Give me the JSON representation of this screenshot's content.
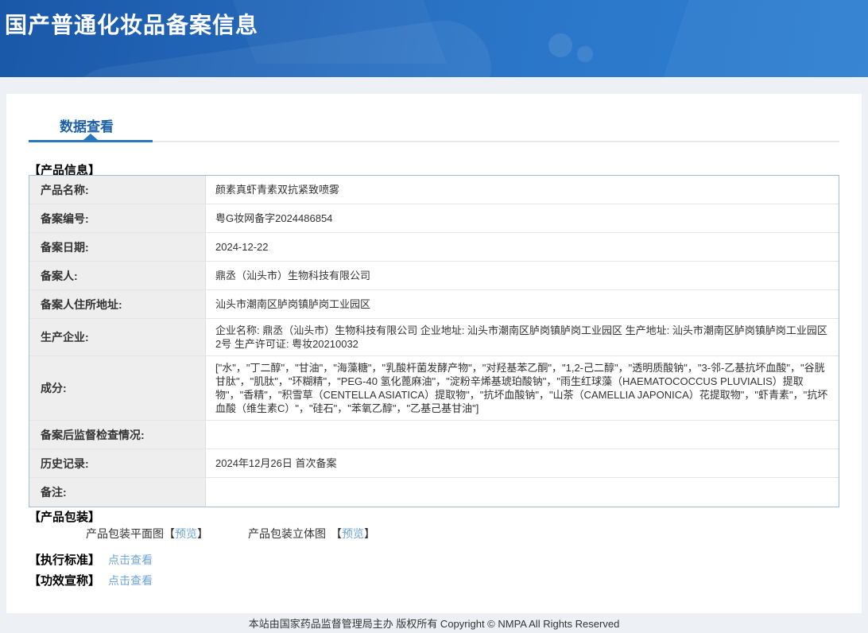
{
  "header": {
    "title": "国产普通化妆品备案信息"
  },
  "tabs": {
    "data_view": "数据查看"
  },
  "sections": {
    "product_info": "【产品信息】",
    "packaging": "【产品包装】",
    "standard": "【执行标准】",
    "efficacy": "【功效宣称】"
  },
  "table": {
    "rows": [
      {
        "label": "产品名称:",
        "value": "颜素真虾青素双抗紧致喷雾"
      },
      {
        "label": "备案编号:",
        "value": "粤G妆网备字2024486854"
      },
      {
        "label": "备案日期:",
        "value": "2024-12-22"
      },
      {
        "label": "备案人:",
        "value": "鼎丞（汕头市）生物科技有限公司"
      },
      {
        "label": "备案人住所地址:",
        "value": "汕头市潮南区胪岗镇胪岗工业园区"
      },
      {
        "label": "生产企业:",
        "value": "企业名称: 鼎丞（汕头市）生物科技有限公司 企业地址: 汕头市潮南区胪岗镇胪岗工业园区 生产地址: 汕头市潮南区胪岗镇胪岗工业园区2号 生产许可证: 粤妆20210032"
      },
      {
        "label": "成分:",
        "value": "[\"水\"，\"丁二醇\"，\"甘油\"，\"海藻糖\"，\"乳酸杆菌发酵产物\"，\"对羟基苯乙酮\"，\"1,2-己二醇\"，\"透明质酸钠\"，\"3-邻-乙基抗坏血酸\"，\"谷胱甘肽\"，\"肌肽\"，\"环糊精\"，\"PEG-40 氢化蓖麻油\"，\"淀粉辛烯基琥珀酸钠\"，\"雨生红球藻（HAEMATOCOCCUS PLUVIALIS）提取物\"，\"香精\"，\"积雪草（CENTELLA ASIATICA）提取物\"，\"抗坏血酸钠\"，\"山茶（CAMELLIA JAPONICA）花提取物\"，\"虾青素\"，\"抗坏血酸（维生素C）\"，\"硅石\"，\"苯氧乙醇\"，\"乙基己基甘油\"]"
      },
      {
        "label": "备案后监督检查情况:",
        "value": ""
      },
      {
        "label": "历史记录:",
        "value": "2024年12月26日 首次备案"
      },
      {
        "label": "备注:",
        "value": ""
      }
    ]
  },
  "packaging": {
    "flat_label": "产品包装平面图",
    "stereo_label": "产品包装立体图",
    "bracket_open": "【",
    "bracket_close": "】",
    "preview_link": "预览"
  },
  "links": {
    "click_to_view": "点击查看"
  },
  "footer": {
    "text": "本站由国家药品监督管理局主办 版权所有 Copyright © NMPA All Rights Reserved"
  },
  "colors": {
    "header_gradient_start": "#1a57a8",
    "header_gradient_end": "#2f80d2",
    "accent_blue": "#2878be",
    "tab_text_blue": "#1d60a8",
    "link_blue": "#6ca5d8",
    "label_cell_bg": "#eeeeee",
    "table_border": "#a3bdd3",
    "page_bg": "#edf1f5"
  }
}
